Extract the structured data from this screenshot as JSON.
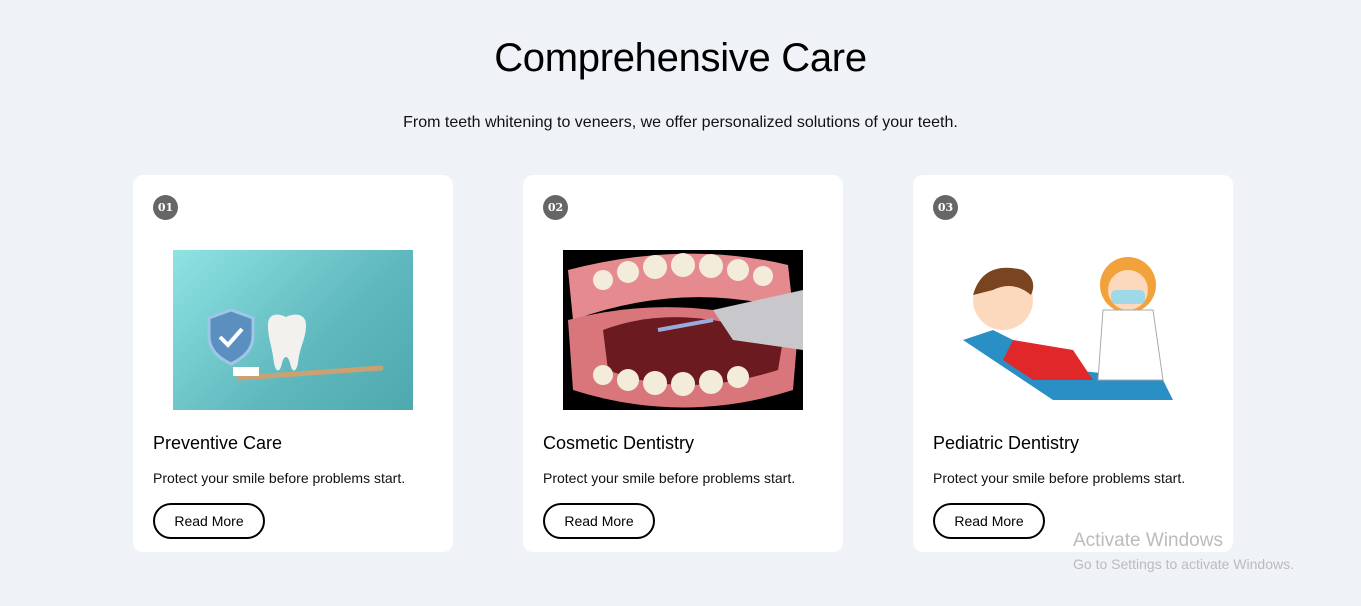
{
  "header": {
    "title": "Comprehensive Care",
    "subtitle": "From teeth whitening to veneers, we offer personalized solutions of your teeth."
  },
  "cards": [
    {
      "number": "01",
      "title": "Preventive Care",
      "description": "Protect your smile before problems start.",
      "button": "Read More",
      "image": "tooth-shield-toothbrush"
    },
    {
      "number": "02",
      "title": "Cosmetic Dentistry",
      "description": "Protect your smile before problems start.",
      "button": "Read More",
      "image": "dental-tool-teeth"
    },
    {
      "number": "03",
      "title": "Pediatric Dentistry",
      "description": "Protect your smile before problems start.",
      "button": "Read More",
      "image": "child-dentist-cartoon"
    }
  ],
  "watermark": {
    "title": "Activate Windows",
    "subtitle": "Go to Settings to activate Windows."
  }
}
